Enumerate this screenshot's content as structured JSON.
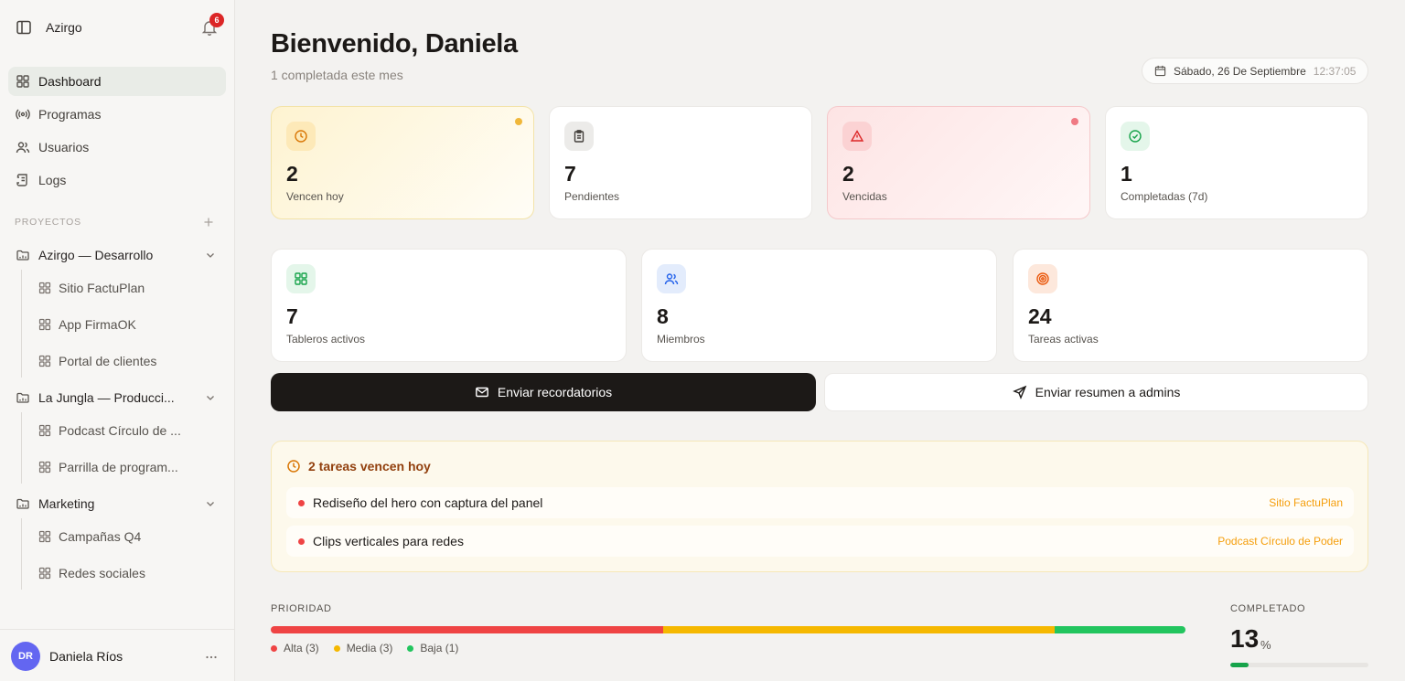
{
  "app": {
    "brand": "Azirgo",
    "notifications": "6"
  },
  "nav": [
    {
      "label": "Dashboard",
      "icon": "grid-icon",
      "active": true
    },
    {
      "label": "Programas",
      "icon": "broadcast-icon"
    },
    {
      "label": "Usuarios",
      "icon": "users-icon"
    },
    {
      "label": "Logs",
      "icon": "scroll-icon"
    }
  ],
  "projects": {
    "section_label": "PROYECTOS",
    "groups": [
      {
        "name": "Azirgo — Desarrollo",
        "items": [
          "Sitio FactuPlan",
          "App FirmaOK",
          "Portal de clientes"
        ]
      },
      {
        "name": "La Jungla — Producci...",
        "items": [
          "Podcast Círculo de ...",
          "Parrilla de program..."
        ]
      },
      {
        "name": "Marketing",
        "items": [
          "Campañas Q4",
          "Redes sociales"
        ]
      }
    ]
  },
  "user": {
    "initials": "DR",
    "name": "Daniela Ríos"
  },
  "header": {
    "title": "Bienvenido, Daniela",
    "subtitle": "1 completada este mes",
    "date": "Sábado, 26 De Septiembre",
    "time": "12:37:05"
  },
  "stats": [
    {
      "value": "2",
      "label": "Vencen hoy",
      "icon": "clock-icon"
    },
    {
      "value": "7",
      "label": "Pendientes",
      "icon": "clipboard-icon"
    },
    {
      "value": "2",
      "label": "Vencidas",
      "icon": "alert-triangle-icon"
    },
    {
      "value": "1",
      "label": "Completadas (7d)",
      "icon": "check-circle-icon"
    }
  ],
  "metrics": [
    {
      "value": "7",
      "label": "Tableros activos",
      "icon": "grid-icon"
    },
    {
      "value": "8",
      "label": "Miembros",
      "icon": "users-icon"
    },
    {
      "value": "24",
      "label": "Tareas activas",
      "icon": "target-icon"
    }
  ],
  "actions": {
    "reminders": "Enviar recordatorios",
    "summary": "Enviar resumen a admins"
  },
  "due_today": {
    "heading": "2 tareas vencen hoy",
    "tasks": [
      {
        "title": "Rediseño del hero con captura del panel",
        "project": "Sitio FactuPlan"
      },
      {
        "title": "Clips verticales para redes",
        "project": "Podcast Círculo de Poder"
      }
    ]
  },
  "priority": {
    "label": "PRIORIDAD",
    "segments": [
      {
        "name": "Alta",
        "count": 3,
        "legend": "Alta (3)",
        "color": "#ef4444"
      },
      {
        "name": "Media",
        "count": 3,
        "legend": "Media (3)",
        "color": "#f5b800"
      },
      {
        "name": "Baja",
        "count": 1,
        "legend": "Baja (1)",
        "color": "#22c55e"
      }
    ]
  },
  "completed": {
    "label": "COMPLETADO",
    "value": "13",
    "unit": "%",
    "percent": 13
  }
}
